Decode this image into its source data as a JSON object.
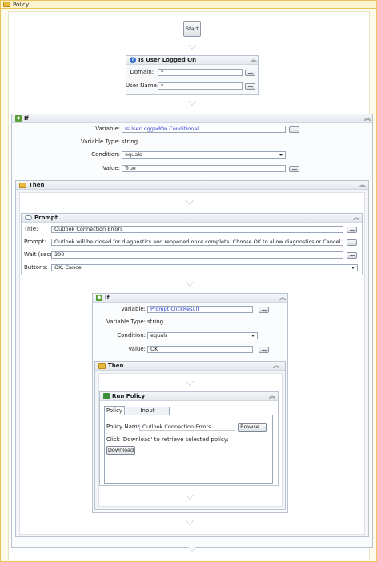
{
  "policy": {
    "title": "Policy"
  },
  "start": {
    "label": "Start"
  },
  "is_logged_on": {
    "title": "Is User Logged On",
    "domain_label": "Domain:",
    "domain_value": "*",
    "username_label": "User Name:",
    "username_value": "*"
  },
  "if1": {
    "title": "If",
    "variable_label": "Variable:",
    "variable_value": "IsUserLoggedOn.Conditional",
    "type_label": "Variable Type:",
    "type_value": "string",
    "condition_label": "Condition:",
    "condition_value": "equals",
    "value_label": "Value:",
    "value_value": "True"
  },
  "then1": {
    "title": "Then"
  },
  "prompt": {
    "title": "Prompt",
    "title_label": "Title:",
    "title_value": "Outlook Connection Errors",
    "prompt_label": "Prompt:",
    "prompt_value": "Outlook will be closed for diagnostics and reopened once complete.  Choose OK to allow diagnostics or Cancel to disallow.",
    "wait_label": "Wait (secs):",
    "wait_value": "300",
    "buttons_label": "Buttons:",
    "buttons_value": "OK, Cancel"
  },
  "if2": {
    "title": "If",
    "variable_label": "Variable:",
    "variable_value": "Prompt.ClickResult",
    "type_label": "Variable Type:",
    "type_value": "string",
    "condition_label": "Condition:",
    "condition_value": "equals",
    "value_label": "Value:",
    "value_value": "OK"
  },
  "then2": {
    "title": "Then"
  },
  "run_policy": {
    "title": "Run Policy",
    "tabs": [
      "Policy",
      "Input Parameters"
    ],
    "policy_name_label": "Policy Name:",
    "policy_name_value": "Outlook Connection Errors",
    "browse_label": "Browse...",
    "hint": "Click 'Download' to retrieve selected policy:",
    "download_label": "Download"
  },
  "colors": {
    "policy_border": "#e8c45a",
    "policy_header": "#fdf3cf",
    "link_blue": "#2a3fd0"
  }
}
